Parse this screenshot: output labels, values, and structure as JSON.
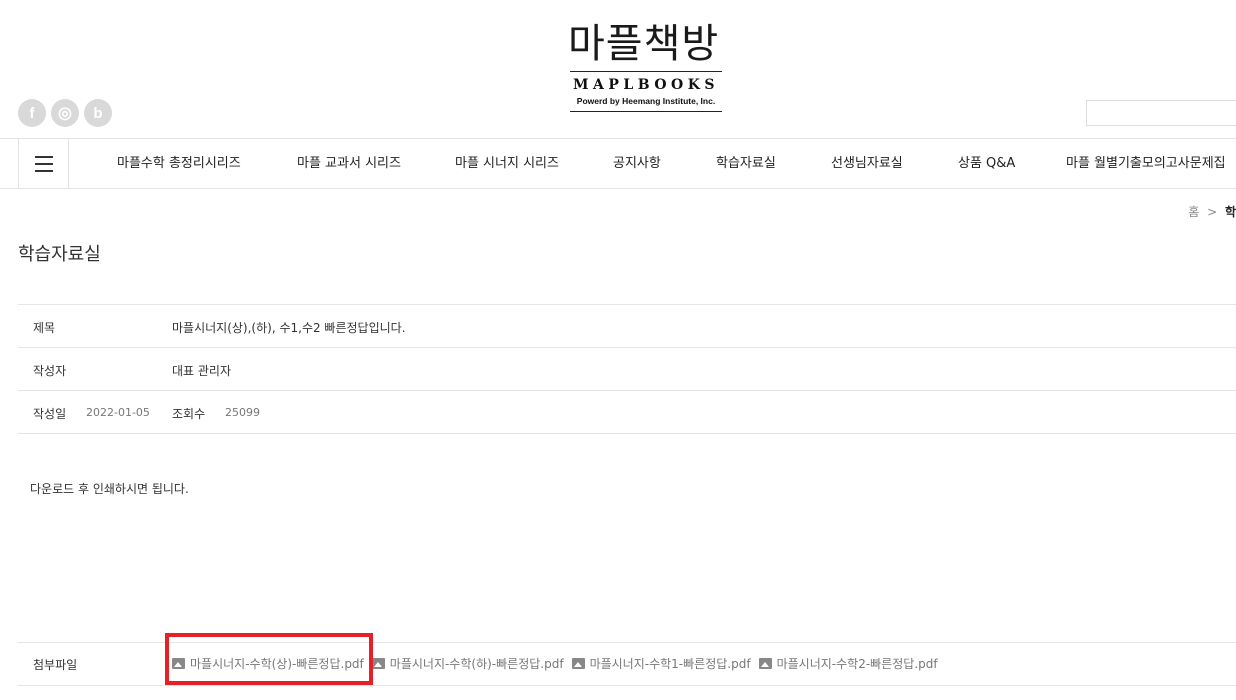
{
  "logo": {
    "korean": "마플책방",
    "english": "MAPLBOOKS",
    "subtitle": "Powerd by Heemang Institute, Inc."
  },
  "social": {
    "facebook": "f",
    "instagram": "◎",
    "blog": "b"
  },
  "search": {
    "placeholder": ""
  },
  "nav": {
    "items": [
      "마플수학 총정리시리즈",
      "마플 교과서 시리즈",
      "마플 시너지 시리즈",
      "공지사항",
      "학습자료실",
      "선생님자료실",
      "상품 Q&A",
      "마플 월별기출모의고사문제집"
    ]
  },
  "breadcrumb": {
    "home": "홈",
    "separator": ">",
    "current": "학"
  },
  "page": {
    "title": "학습자료실"
  },
  "post": {
    "title_label": "제목",
    "title": "마플시너지(상),(하), 수1,수2 빠른정답입니다.",
    "author_label": "작성자",
    "author": "대표 관리자",
    "date_label": "작성일",
    "date": "2022-01-05",
    "views_label": "조회수",
    "views": "25099",
    "body": "다운로드 후 인쇄하시면 됩니다.",
    "attachments_label": "첨부파일",
    "attachments": [
      "마플시너지-수학(상)-빠른정답.pdf",
      "마플시너지-수학(하)-빠른정답.pdf",
      "마플시너지-수학1-빠른정답.pdf",
      "마플시너지-수학2-빠른정답.pdf"
    ]
  },
  "colors": {
    "highlight": "#e32127",
    "social_bg": "#d9d9d9",
    "border": "#e5e5e5"
  }
}
